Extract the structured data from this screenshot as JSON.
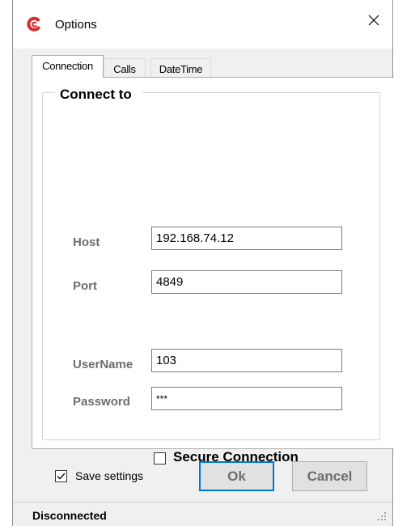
{
  "window": {
    "title": "Options",
    "app_icon": "app-logo-icon",
    "close_icon": "close-icon"
  },
  "tabs": [
    {
      "label": "Connection",
      "active": true
    },
    {
      "label": "Calls",
      "active": false
    },
    {
      "label": "DateTime",
      "active": false
    }
  ],
  "connection": {
    "group_title": "Connect to",
    "host_label": "Host",
    "host_value": "192.168.74.12",
    "port_label": "Port",
    "port_value": "4849",
    "username_label": "UserName",
    "username_value": "103",
    "password_label": "Password",
    "password_value": "***",
    "secure_label": "Secure Connection",
    "secure_checked": false
  },
  "footer": {
    "save_label": "Save settings",
    "save_checked": true,
    "ok_label": "Ok",
    "cancel_label": "Cancel"
  },
  "status": {
    "text": "Disconnected",
    "grip_icon": "resize-grip-icon"
  },
  "colors": {
    "accent": "#0078d7",
    "brand": "#d32f2f",
    "label_gray": "#6d6d6d"
  }
}
